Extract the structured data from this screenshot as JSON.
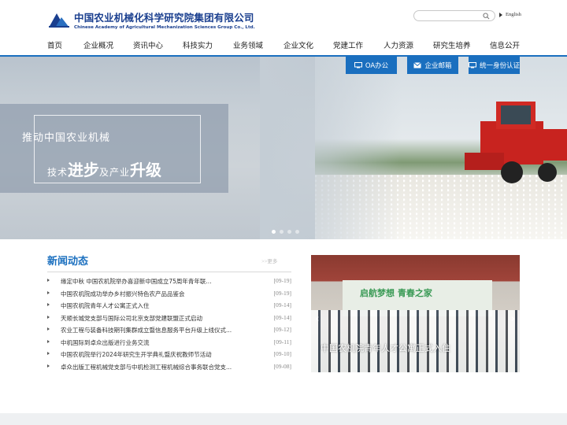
{
  "header": {
    "org_cn": "中国农业机械化科学研究院集团有限公司",
    "org_en": "Chinese Academy of Agricultural Mechanization Sciences Group Co., Ltd.",
    "search_placeholder": "",
    "language": "English"
  },
  "nav": [
    "首页",
    "企业概况",
    "资讯中心",
    "科技实力",
    "业务领域",
    "企业文化",
    "党建工作",
    "人力资源",
    "研究生培养",
    "信息公开"
  ],
  "quick_links": [
    "OA办公",
    "企业邮箱",
    "统一身份认证"
  ],
  "banner": {
    "slogan_line1": "推动中国农业机械",
    "slogan_a": "技术",
    "slogan_b": "进步",
    "slogan_c": "及产业",
    "slogan_d": "升级"
  },
  "news": {
    "title": "新闻动态",
    "more": ">>更多",
    "items": [
      {
        "title": "缘定中秋 中国农机院举办喜迎新中国成立75周年青年联...",
        "date": "[09-19]"
      },
      {
        "title": "中国农机院成功举办乡村振兴特色农产品品鉴会",
        "date": "[09-19]"
      },
      {
        "title": "中国农机院青年人才公寓正式入住",
        "date": "[09-14]"
      },
      {
        "title": "天顺长城党支部与国际公司北京支部党建联盟正式启动",
        "date": "[09-14]"
      },
      {
        "title": "农业工程与装备科技期刊集群成立暨信息服务平台升级上线仪式...",
        "date": "[09-12]"
      },
      {
        "title": "中机国际到卓众出版进行业务交流",
        "date": "[09-11]"
      },
      {
        "title": "中国农机院举行2024年研究生开学典礼暨庆祝教师节活动",
        "date": "[09-10]"
      },
      {
        "title": "卓众出版工程机械党支部与中机检测工程机械综合事务联合党支...",
        "date": "[09-08]"
      }
    ]
  },
  "photo": {
    "banner_text": "启航梦想 青春之家",
    "caption": "中国农机院青年人才公寓正式入住",
    "prev": "‹",
    "next": "›"
  },
  "colors": {
    "brand": "#1a6fbf",
    "logo": "#1a3f8f"
  }
}
